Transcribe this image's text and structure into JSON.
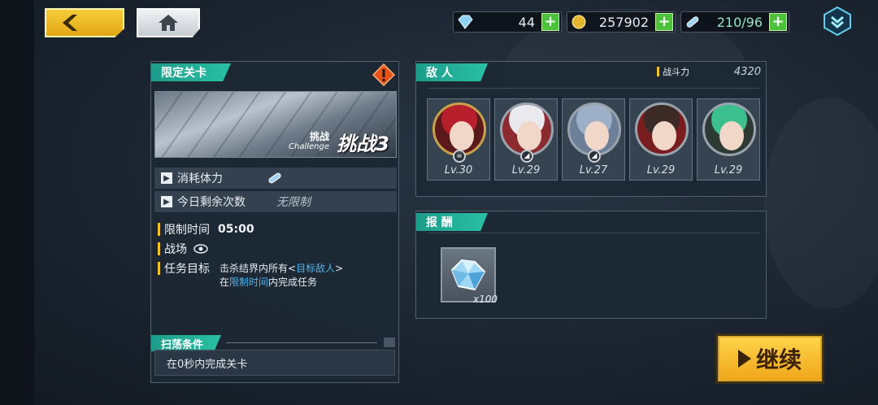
{
  "topbar": {
    "back_icon": "chevron-left-icon",
    "home_icon": "home-icon",
    "gems": "44",
    "coins": "257902",
    "stamina": "210/96",
    "menu_icon": "dropdown-menu-icon"
  },
  "stage": {
    "tag": "限定关卡",
    "sub_small": "挑战",
    "sub_en": "Challenge",
    "big_label": "挑战3",
    "cost_label": "消耗体力",
    "remaining_label": "今日剩余次数",
    "remaining_value": "无限制",
    "time_label": "限制时间",
    "time_value": "05:00",
    "field_label": "战场",
    "objective_label": "任务目标",
    "objective_line1_pre": "击杀结界内所有<",
    "objective_line1_link": "目标敌人",
    "objective_line1_post": ">",
    "objective_line2_pre": "在",
    "objective_line2_link": "限制时间",
    "objective_line2_post": "内完成任务",
    "sweep_tag": "扫荡条件",
    "sweep_text": "在0秒内完成关卡"
  },
  "enemies": {
    "tag": "敌  人",
    "power_label": "战斗力",
    "power_value": "4320",
    "list": [
      {
        "level": "Lv.30",
        "hair": "#b81f2c",
        "bg": "#5a1a1c",
        "ring": "#c7a24a"
      },
      {
        "level": "Lv.29",
        "hair": "#e9e9ee",
        "bg": "#8b2a2f",
        "ring": "#9aa3ad"
      },
      {
        "level": "Lv.27",
        "hair": "#9eb0c8",
        "bg": "#6d7f99",
        "ring": "#9aa3ad"
      },
      {
        "level": "Lv.29",
        "hair": "#3b2a26",
        "bg": "#7a1d1f",
        "ring": "#9aa3ad"
      },
      {
        "level": "Lv.29",
        "hair": "#3cbf8e",
        "bg": "#2c3a33",
        "ring": "#9aa3ad"
      }
    ]
  },
  "reward": {
    "tag": "报  酬",
    "item_icon": "crystal-icon",
    "count": "x100"
  },
  "continue_label": "继续",
  "colors": {
    "accent_teal": "#2ac0a6",
    "accent_yellow": "#f2c12e",
    "link_blue": "#4fb4f0",
    "plus_green": "#4cc23b"
  }
}
